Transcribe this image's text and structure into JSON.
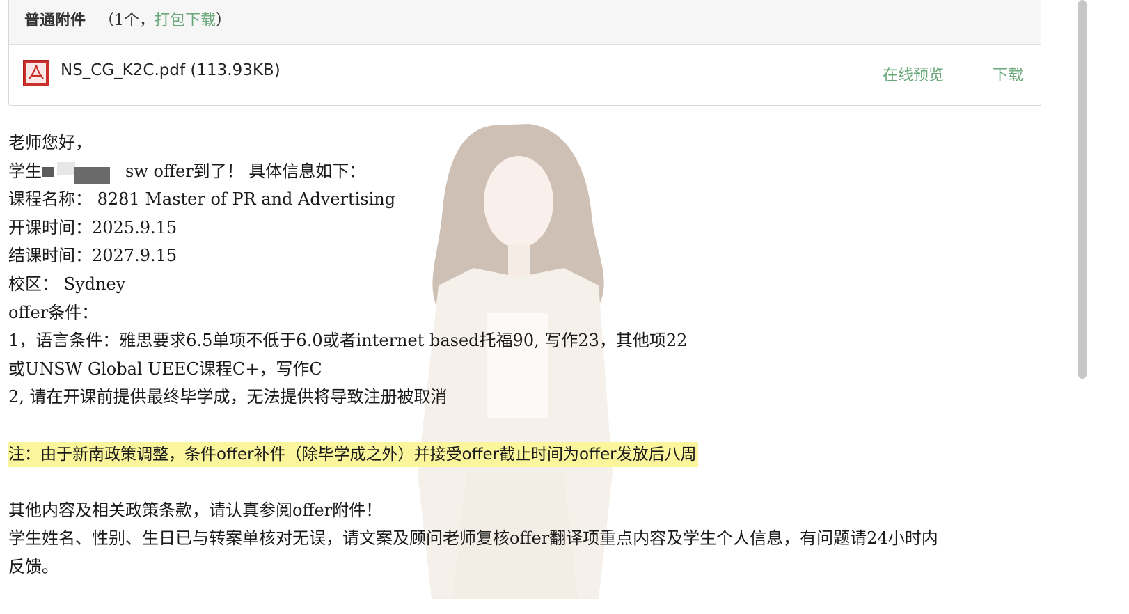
{
  "attachments": {
    "heading": "普通附件",
    "count_prefix": "（1个，",
    "pack_download": "打包下载",
    "count_suffix": "）",
    "file": {
      "name": "NS_CG_K2C.pdf (113.93KB)",
      "icon": "pdf-icon",
      "preview_label": "在线预览",
      "download_label": "下载"
    }
  },
  "email": {
    "greeting": "老师您好，",
    "student_prefix": "学生",
    "student_suffix": "sw offer到了！ 具体信息如下：",
    "course": "课程名称：  8281 Master of PR and Advertising",
    "start": "开课时间：2025.9.15",
    "end": "结课时间：2027.9.15",
    "campus": "校区：  Sydney",
    "conditions_title": "offer条件：",
    "condition_1": "1，语言条件：雅思要求6.5单项不低于6.0或者internet based托福90, 写作23，其他项22",
    "condition_1b": "或UNSW Global UEEC课程C+，写作C",
    "condition_2": "2, 请在开课前提供最终毕学成，无法提供将导致注册被取消",
    "notice": "注：由于新南政策调整，条件offer补件（除毕学成之外）并接受offer截止时间为offer发放后八周",
    "other": "其他内容及相关政策条款，请认真参阅offer附件！",
    "verify": "学生姓名、性别、生日已与转案单核对无误，请文案及顾问老师复核offer翻译项重点内容及学生个人信息，有问题请24小时内",
    "feedback": "反馈。"
  },
  "colors": {
    "link": "#6aa87a",
    "highlight": "#fbf59b",
    "pdf_red": "#c9302c"
  }
}
